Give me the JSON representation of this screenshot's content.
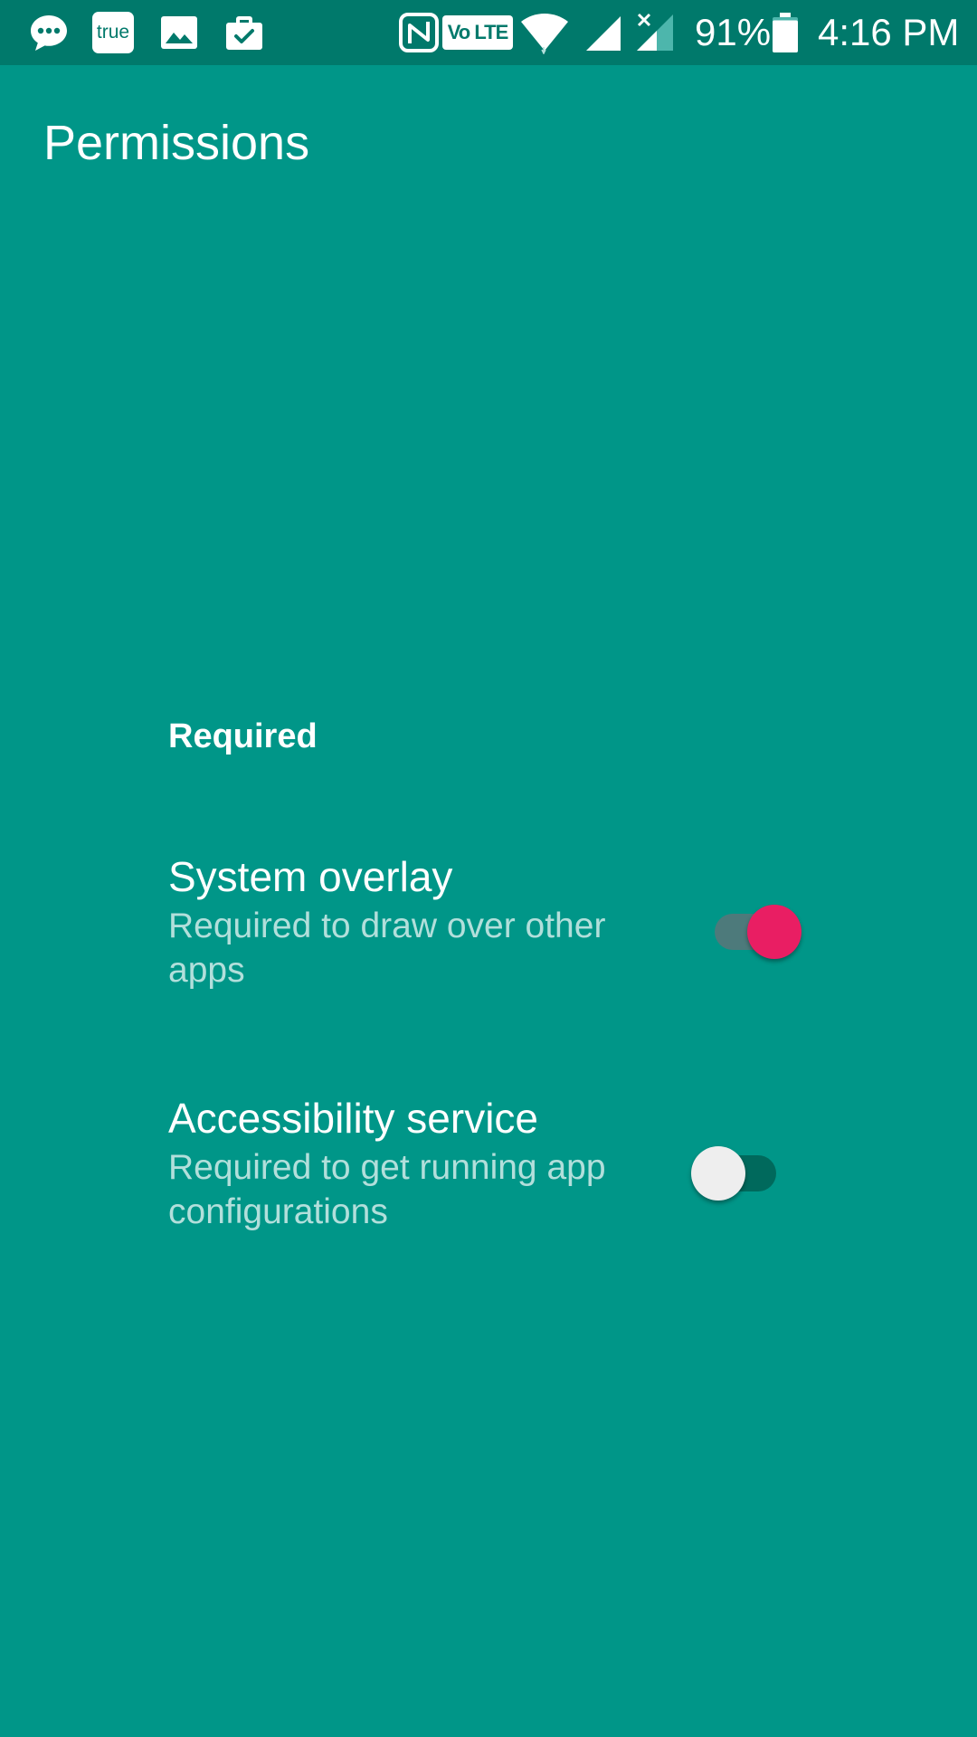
{
  "status_bar": {
    "notification_icons": [
      "chat-bubble-icon",
      "true-app-icon",
      "gallery-icon",
      "work-briefcase-icon"
    ],
    "true_badge_label": "true",
    "system_icons": [
      "nfc-icon",
      "volte-icon",
      "wifi-icon",
      "signal-icon",
      "signal-no-service-icon",
      "battery-icon"
    ],
    "volte_label": "Vo LTE",
    "battery_percent": "91%",
    "battery_level": 0.91,
    "time": "4:16 PM"
  },
  "page": {
    "title": "Permissions"
  },
  "section": {
    "header": "Required"
  },
  "permissions": [
    {
      "title": "System overlay",
      "summary": "Required to draw over other apps",
      "enabled": true
    },
    {
      "title": "Accessibility service",
      "summary": "Required to get running app configurations",
      "enabled": false
    }
  ],
  "colors": {
    "background": "#009688",
    "status_bar": "#00796B",
    "switch_on_thumb": "#E91E63",
    "switch_off_thumb": "#EEEEEE",
    "summary_text": "#B2DFDB"
  }
}
